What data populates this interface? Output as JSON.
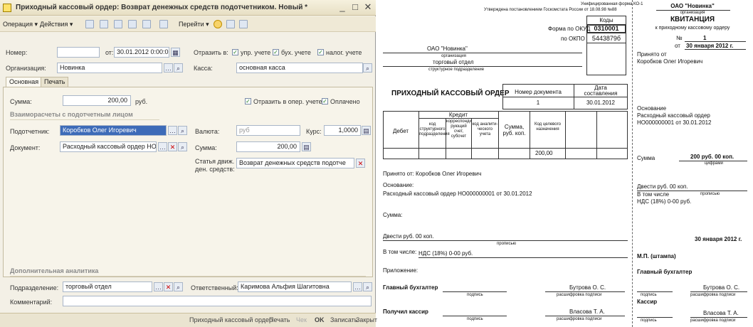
{
  "window": {
    "title": "Приходный кассовый ордер: Возврат денежных средств подотчетником. Новый *",
    "controls": [
      "_",
      "□",
      "✕"
    ]
  },
  "toolbar": {
    "operation": "Операция ▾",
    "actions": "Действия ▾",
    "goto": "Перейти ▾"
  },
  "header": {
    "number_label": "Номер:",
    "number_value": "",
    "from_label": "от:",
    "date_value": "30.01.2012 0:00:00",
    "reflect_label": "Отразить в:",
    "cb_upr": "упр. учете",
    "cb_buh": "бух. учете",
    "cb_nal": "налог. учете",
    "org_label": "Организация:",
    "org_value": "Новинка",
    "cash_label": "Касса:",
    "cash_value": "основная касса"
  },
  "tabs": {
    "main": "Основная",
    "print": "Печать"
  },
  "main": {
    "sum_label": "Сумма:",
    "sum_value": "200,00",
    "currency": "руб.",
    "cb_oper": "Отразить в опер. учете",
    "cb_paid": "Оплачено",
    "section_settlements": "Взаиморасчеты с подотчетным лицом",
    "person_label": "Подотчетник:",
    "person_value": "Коробков Олег Игоревич",
    "currency_label": "Валюта:",
    "currency_value": "руб",
    "rate_label": "Курс:",
    "rate_value": "1,0000",
    "doc_label": "Документ:",
    "doc_value": "Расходный кассовый ордер НОО",
    "sum2_label": "Сумма:",
    "sum2_value": "200,00",
    "article_label1": "Статья движ.",
    "article_label2": "ден. средств:",
    "article_value": "Возврат денежных средств подотче"
  },
  "extra": {
    "section": "Дополнительная аналитика",
    "dept_label": "Подразделение:",
    "dept_value": "торговый отдел",
    "resp_label": "Ответственный:",
    "resp_value": "Каримова Альфия Шагитовна",
    "comment_label": "Комментарий:",
    "comment_value": ""
  },
  "statusbar": {
    "pko": "Приходный кассовый ордер",
    "print": "Печать",
    "check": "Чек",
    "ok": "OK",
    "save": "Записать",
    "close": "Закрыть"
  },
  "form": {
    "unified": "Унифицированная форма КО-1",
    "approved": "Утверждена постановлением Госкомстата России от 18.08.98 №88",
    "codes": "Коды",
    "okud_label": "Форма по ОКУД",
    "okud": "0310001",
    "okpo_label": "по ОКПО",
    "okpo": "5443879б",
    "org": "ОАО \"Новинка\"",
    "org_caption": "организация",
    "dept": "торговый отдел",
    "dept_caption": "структурное подразделение",
    "title": "ПРИХОДНЫЙ КАССОВЫЙ ОРДЕР",
    "doc_num_label": "Номер документа",
    "date_label1": "Дата",
    "date_label2": "составления",
    "doc_num": "1",
    "date": "30.01.2012",
    "debit": "Дебет",
    "credit": "Кредит",
    "col_code_struct": "код структурного подразделения",
    "col_corr": "корреспонди рующий счет, субсчет",
    "col_analytic": "код аналити- ческого учета",
    "col_sum": "Сумма, руб. коп.",
    "col_purpose": "Код целевого назначения",
    "sum_cell": "200,00",
    "received_from": "Принято от:  Коробков Олег Игоревич",
    "basis_label": "Основание:",
    "basis": "Расходный кассовый ордер НО000000001 от 30.01.2012",
    "sum_label": "Сумма:",
    "sum_words": "Двести руб. 00 коп.",
    "words_caption": "прописью",
    "incl": "В том числе:",
    "vat": "НДС (18%) 0-00 руб.",
    "attach": "Приложение:",
    "chief": "Главный бухгалтер",
    "sign_caption": "подпись",
    "decode_caption": "расшифровка подписи",
    "chief_name": "Бутрова О. С.",
    "cashier": "Получил кассир",
    "cashier_name": "Власова Т. А."
  },
  "receipt": {
    "org": "ОАО \"Новинка\"",
    "org_caption": "организация",
    "title": "КВИТАНЦИЯ",
    "to_order": "к приходному кассовому ордеру",
    "num_label": "№",
    "num": "1",
    "from_label": "от",
    "date": "30 января 2012 г.",
    "received_label": "Принято от",
    "received": "Коробков Олег Игоревич",
    "basis_label": "Основание",
    "basis1": "Расходный кассовый ордер",
    "basis2": "НО000000001 от 30.01.2012",
    "sum_label": "Сумма",
    "sum": "200 руб. 00 коп.",
    "digits_caption": "цифрами",
    "words": "Двести руб. 00 коп.",
    "incl": "В том числе",
    "words_caption": "прописью",
    "vat": "НДС (18%) 0-00 руб.",
    "date2": "30 января 2012 г.",
    "stamp": "М.П. (штампа)",
    "chief": "Главный бухгалтер",
    "sign_caption": "подпись",
    "decode_caption": "расшифровка подписи",
    "chief_name": "Бутрова О. С.",
    "cashier": "Кассир",
    "cashier_name": "Власова Т. А."
  }
}
